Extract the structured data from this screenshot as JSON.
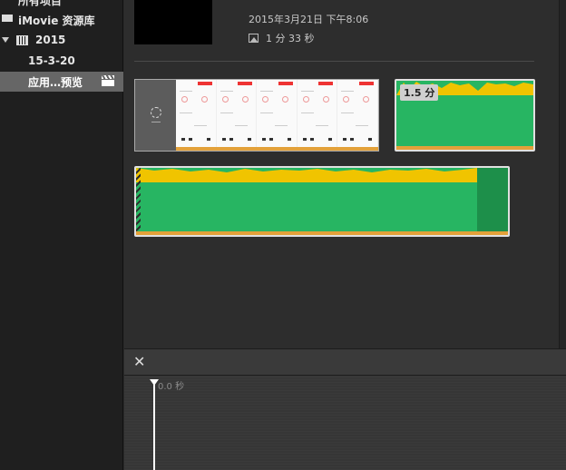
{
  "sidebar": {
    "all_projects": "所有项目",
    "library": "iMovie 资源库",
    "year": "2015",
    "event": "15-3-20",
    "selected_event": "应用…预览"
  },
  "browser": {
    "top_clip": {
      "date": "2015年3月21日 下午8:06",
      "duration": "1 分 33 秒"
    },
    "clip2_badge": "1.5 分"
  },
  "timeline": {
    "close_glyph": "✕",
    "timecode": "0.0 秒"
  },
  "colors": {
    "audio_yellow": "#f0c400",
    "clip_green": "#27b562",
    "selection": "#666666",
    "orange_bar": "#e3a13a"
  }
}
